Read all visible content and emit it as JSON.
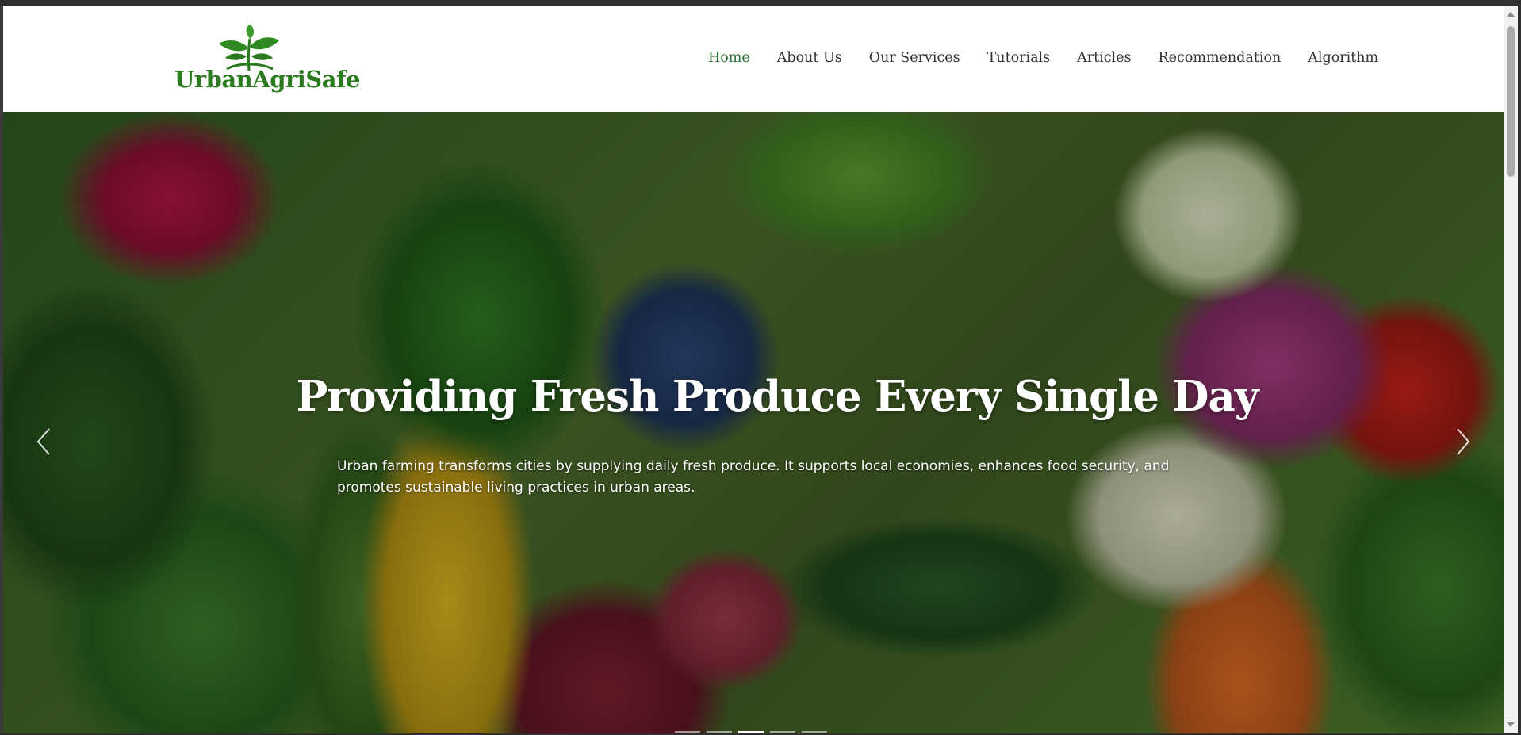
{
  "brand": {
    "name": "UrbanAgriSafe",
    "logo_icon": "sprout-icon",
    "color": "#2a7a1e"
  },
  "nav": {
    "items": [
      {
        "label": "Home",
        "active": true
      },
      {
        "label": "About Us",
        "active": false
      },
      {
        "label": "Our Services",
        "active": false
      },
      {
        "label": "Tutorials",
        "active": false
      },
      {
        "label": "Articles",
        "active": false
      },
      {
        "label": "Recommendation",
        "active": false
      },
      {
        "label": "Algorithm",
        "active": false
      }
    ],
    "active_color": "#2a6e31"
  },
  "hero": {
    "title": "Providing Fresh Produce Every Single Day",
    "description": "Urban farming transforms cities by supplying daily fresh produce. It supports local economies, enhances food security, and promotes sustainable living practices in urban areas.",
    "image": "vegetables-photo",
    "prev_icon": "chevron-left-icon",
    "next_icon": "chevron-right-icon",
    "slide_count": 5,
    "active_slide": 3
  }
}
